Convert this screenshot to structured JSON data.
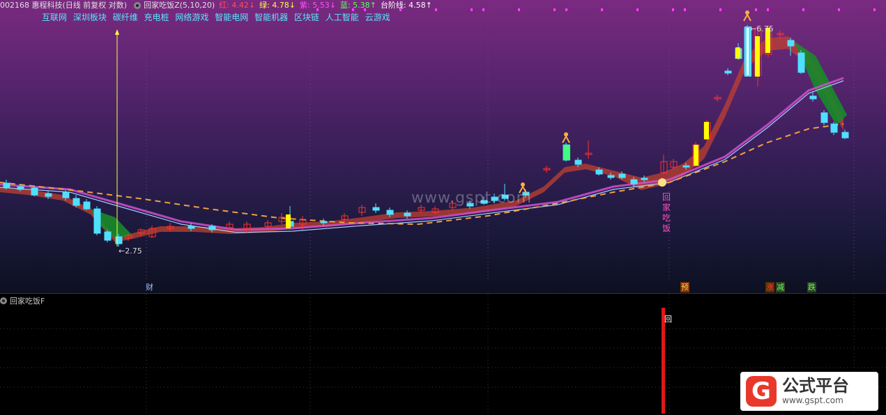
{
  "header": {
    "stock": "002168 惠程科技(日线 前复权 对数)",
    "indicator": "回家吃饭Z(5,10,20)",
    "red_label": "红: 4.42↓",
    "green_label": "绿: 4.78↓",
    "purple_label": "紫: 5.53↓",
    "blue_label": "蓝: 5.38↑",
    "step_label": "台阶线: 4.58↑"
  },
  "concepts": [
    "互联网",
    "深圳板块",
    "碳纤维",
    "充电桩",
    "网络游戏",
    "智能电网",
    "智能机器",
    "区块链",
    "人工智能",
    "云游戏"
  ],
  "annotations": {
    "low": "←2.75",
    "high": "←6.75",
    "signal_text": "回家吃饭"
  },
  "signals": [
    {
      "text": "财",
      "color": "#a0c0ff"
    },
    {
      "text": "预",
      "color": "#ffd060"
    },
    {
      "text": "涨",
      "color": "#ff4040"
    },
    {
      "text": "减",
      "color": "#40ff40"
    },
    {
      "text": "跌",
      "color": "#40ff40"
    }
  ],
  "sub": {
    "title": "回家吃饭F",
    "marker": "回"
  },
  "watermark": "www.gspt.com",
  "logo": {
    "name": "公式平台",
    "url": "www.gspt.com"
  },
  "colors": {
    "up": "#ff3030",
    "down": "#50e0ff",
    "yellow": "#ffff00",
    "green_band": "#1a8a2a",
    "red_band": "#c04030",
    "purple_line": "#d050d0",
    "step": "#f0a040"
  }
}
